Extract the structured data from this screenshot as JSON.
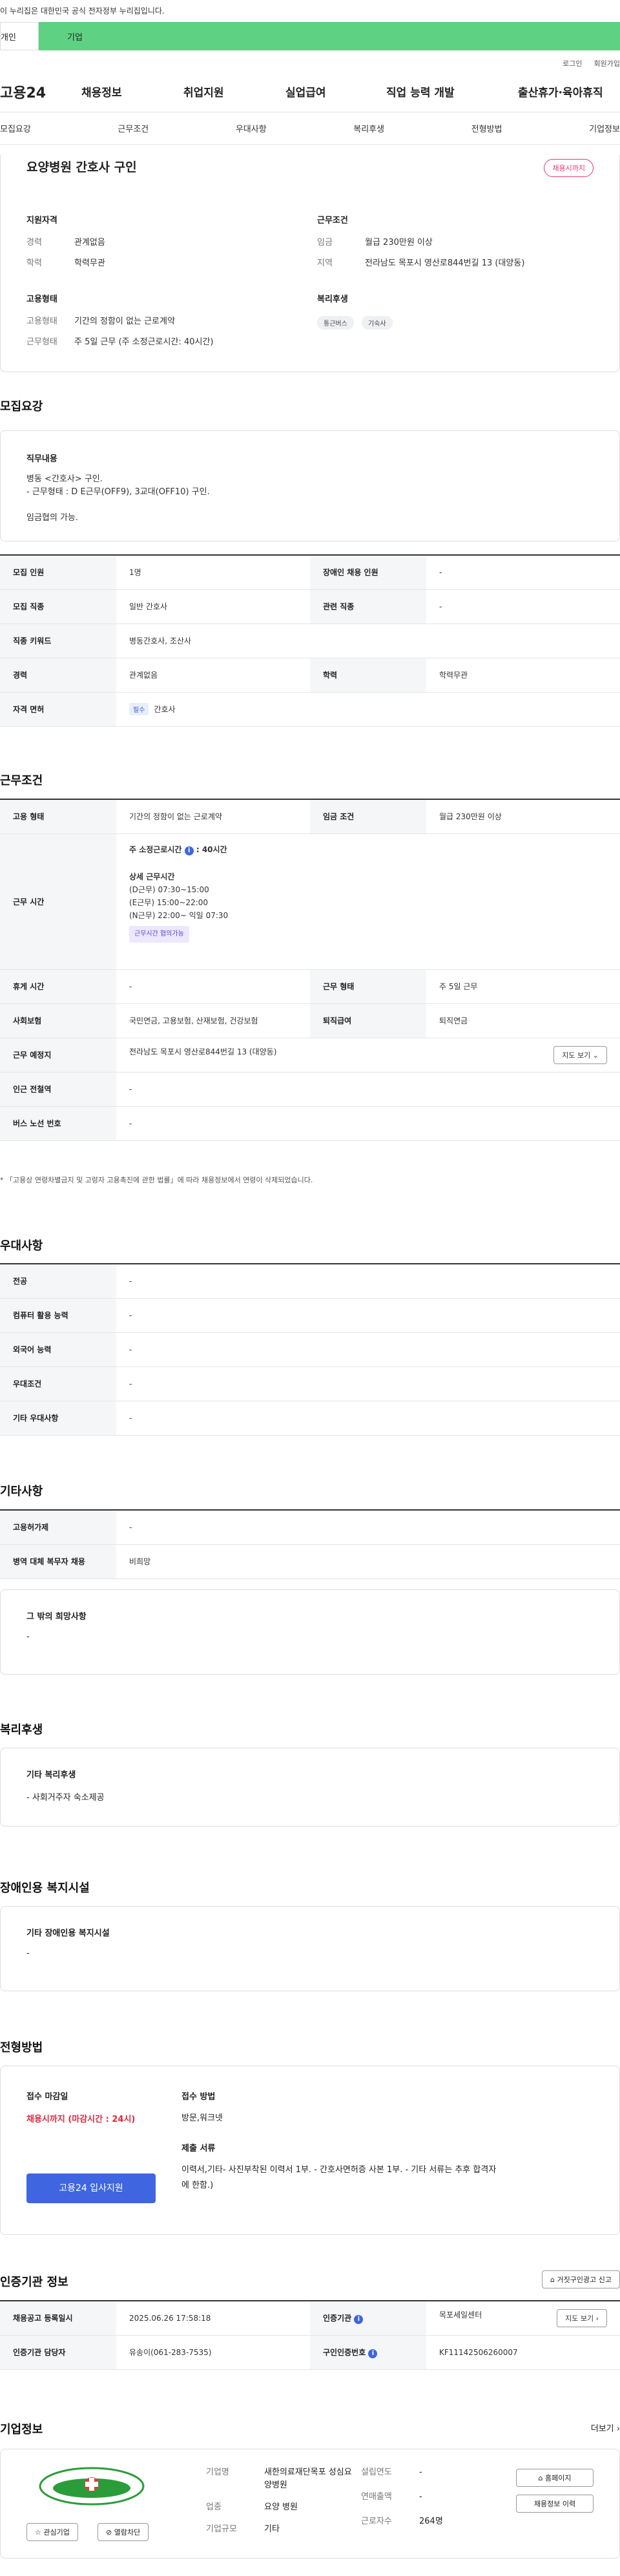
{
  "banner": "이 누리집은 대한민국 공식 전자정부 누리집입니다.",
  "userbar": {
    "personal": "개인",
    "company": "기업"
  },
  "utils": [
    "로그인",
    "회원가입"
  ],
  "gnb": {
    "logo": "고용24",
    "items": [
      "채용정보",
      "취업지원",
      "실업급여",
      "직업 능력 개발",
      "출산휴가·육아휴직"
    ]
  },
  "subnav": [
    "모집요강",
    "근무조건",
    "우대사항",
    "복리후생",
    "전형방법",
    "기업정보"
  ],
  "job": {
    "title": "요양병원 간호사 구인",
    "status_badge": "채용시까지",
    "qual_title": "지원자격",
    "qual": [
      {
        "k": "경력",
        "v": "관계없음"
      },
      {
        "k": "학력",
        "v": "학력무관"
      }
    ],
    "cond_title": "근무조건",
    "cond": [
      {
        "k": "임금",
        "v": "월급 230만원 이상"
      },
      {
        "k": "지역",
        "v": "전라남도 목포시 영산로844번길 13 (대양동)"
      }
    ],
    "emp_title": "고용형태",
    "emp": [
      {
        "k": "고용형태",
        "v": "기간의 정함이 없는 근로계약"
      },
      {
        "k": "근무형태",
        "v": "주 5일 근무 (주 소정근로시간: 40시간)"
      }
    ],
    "welfare_title": "복리후생",
    "welfare_chips": [
      "통근버스",
      "기숙사"
    ]
  },
  "recruit": {
    "section": "모집요강",
    "duty_title": "직무내용",
    "duty_lines": [
      "병동 <간호사> 구인.",
      "- 근무형태 :  D E근무(OFF9), 3교대(OFF10) 구인.",
      "",
      "임금협의 가능."
    ],
    "rows": [
      {
        "l1": "모집 인원",
        "v1": "1명",
        "l2": "장애인 채용 인원",
        "v2": "-"
      },
      {
        "l1": "모집 직종",
        "v1": "일반 간호사",
        "l2": "관련 직종",
        "v2": "-"
      },
      {
        "l1": "직종 키워드",
        "v1": "병동간호사, 조산사"
      },
      {
        "l1": "경력",
        "v1": "관계없음",
        "l2": "학력",
        "v2": "학력무관"
      },
      {
        "l1": "자격 면허",
        "chip": "필수",
        "v1": "간호사"
      }
    ]
  },
  "work": {
    "section": "근무조건",
    "emp_type_label": "고용 형태",
    "emp_type": "기간의 정함이 없는 근로계약",
    "wage_label": "임금 조건",
    "wage": "월급 230만원 이상",
    "hours_label": "근무 시간",
    "weekly_hours_label": "주 소정근로시간",
    "weekly_hours": ": 40시간",
    "detail_title": "상세 근무시간",
    "details": [
      "(D근무) 07:30~15:00",
      "(E근무) 15:00~22:00",
      "(N근무) 22:00~ 익일 07:30"
    ],
    "tag": "근무시간 협의가능",
    "rows": [
      {
        "l1": "휴게 시간",
        "v1": "-",
        "l2": "근무 형태",
        "v2": "주 5일 근무"
      },
      {
        "l1": "사회보험",
        "v1": "국민연금, 고용보험, 산재보험, 건강보험",
        "l2": "퇴직급여",
        "v2": "퇴직연금"
      }
    ],
    "location_label": "근무 예정지",
    "location": "전라남도 목포시 영산로844번길 13 (대양동)",
    "map_button": "지도 보기",
    "station_label": "인근 전철역",
    "station": "-",
    "bus_label": "버스 노선 번호",
    "bus": "-",
    "note": "* 「고용상 연령차별금지 및 고령자 고용촉진에 관한 법률」에 따라 채용정보에서 연령이 삭제되었습니다."
  },
  "pref": {
    "section": "우대사항",
    "rows": [
      {
        "l": "전공",
        "v": "-"
      },
      {
        "l": "컴퓨터 활용 능력",
        "v": "-"
      },
      {
        "l": "외국어 능력",
        "v": "-"
      },
      {
        "l": "우대조건",
        "v": "-"
      },
      {
        "l": "기타 우대사항",
        "v": "-"
      }
    ]
  },
  "etc": {
    "section": "기타사항",
    "rows": [
      {
        "l": "고용허가제",
        "v": "-"
      },
      {
        "l": "병역 대체 복무자 채용",
        "v": "비희망"
      }
    ],
    "box_title": "그 밖의 희망사항",
    "box_value": "-"
  },
  "benefit": {
    "section": "복리후생",
    "box_title": "기타 복리후생",
    "box_value": "- 사회거주자 숙소제공"
  },
  "disab": {
    "section": "장애인용 복지시설",
    "box_title": "기타 장애인용 복지시설",
    "box_value": "-"
  },
  "screen": {
    "section": "전형방법",
    "deadline_label": "접수 마감일",
    "deadline": "채용시까지 (마감시간 : 24시)",
    "apply_button": "고용24 입사지원",
    "method_label": "접수 방법",
    "method": "방문,워크넷",
    "docs_label": "제출 서류",
    "docs_lines": [
      "이력서,기타- 사진부착된 이력서 1부. - 간호사면허증 사본 1부.  - 기타 서류는 추후 합격자",
      "에 한함.)"
    ]
  },
  "cert": {
    "section": "인증기관 정보",
    "report_button": "거짓구인광고 신고",
    "rows": [
      {
        "l1": "채용공고 등록일시",
        "v1": "2025.06.26 17:58:18",
        "l2": "인증기관",
        "v2": "목포세일센터",
        "btn": "지도 보기"
      },
      {
        "l1": "인증기관 담당자",
        "v1": "유송이(061-283-7535)",
        "l2": "구인인증번호",
        "v2": "KF11142506260007"
      }
    ]
  },
  "company": {
    "section": "기업정보",
    "more": "더보기",
    "fav_button": "관심기업",
    "block_button": "열람차단",
    "fields": [
      {
        "k": "기업명",
        "v": "새한의료재단목포 성심요양병원"
      },
      {
        "k": "업종",
        "v": "요양 병원"
      },
      {
        "k": "기업규모",
        "v": "기타"
      }
    ],
    "fields2": [
      {
        "k": "설립연도",
        "v": "-"
      },
      {
        "k": "연매출액",
        "v": "-"
      },
      {
        "k": "근로자수",
        "v": "264명"
      }
    ],
    "home_button": "홈페이지",
    "history_button": "채용정보 이력"
  }
}
